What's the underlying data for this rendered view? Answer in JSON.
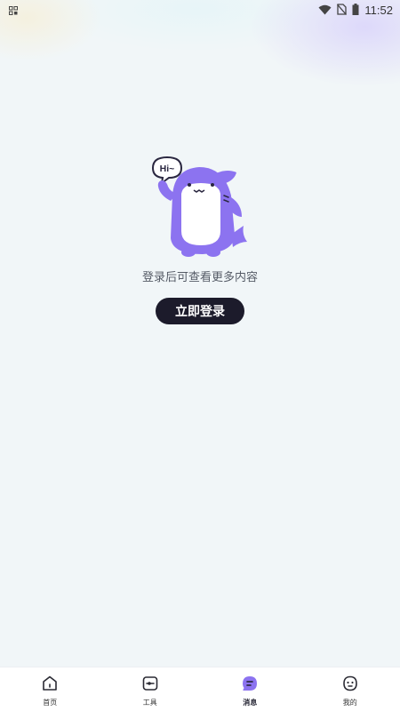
{
  "status_bar": {
    "time": "11:52",
    "icons": [
      "screenshot-icon",
      "wifi-icon",
      "no-sim-icon",
      "battery-icon"
    ]
  },
  "empty_state": {
    "mascot": "shark-mascot",
    "bubble_text": "Hi~",
    "message": "登录后可查看更多内容",
    "login_label": "立即登录"
  },
  "tabbar": {
    "active_index": 2,
    "items": [
      {
        "label": "首页",
        "icon": "home-icon"
      },
      {
        "label": "工具",
        "icon": "tools-icon"
      },
      {
        "label": "消息",
        "icon": "message-icon"
      },
      {
        "label": "我的",
        "icon": "profile-icon"
      }
    ]
  },
  "colors": {
    "accent": "#8c73f0",
    "button_bg": "#1c1b2b",
    "page_bg": "#f1f6f8"
  }
}
